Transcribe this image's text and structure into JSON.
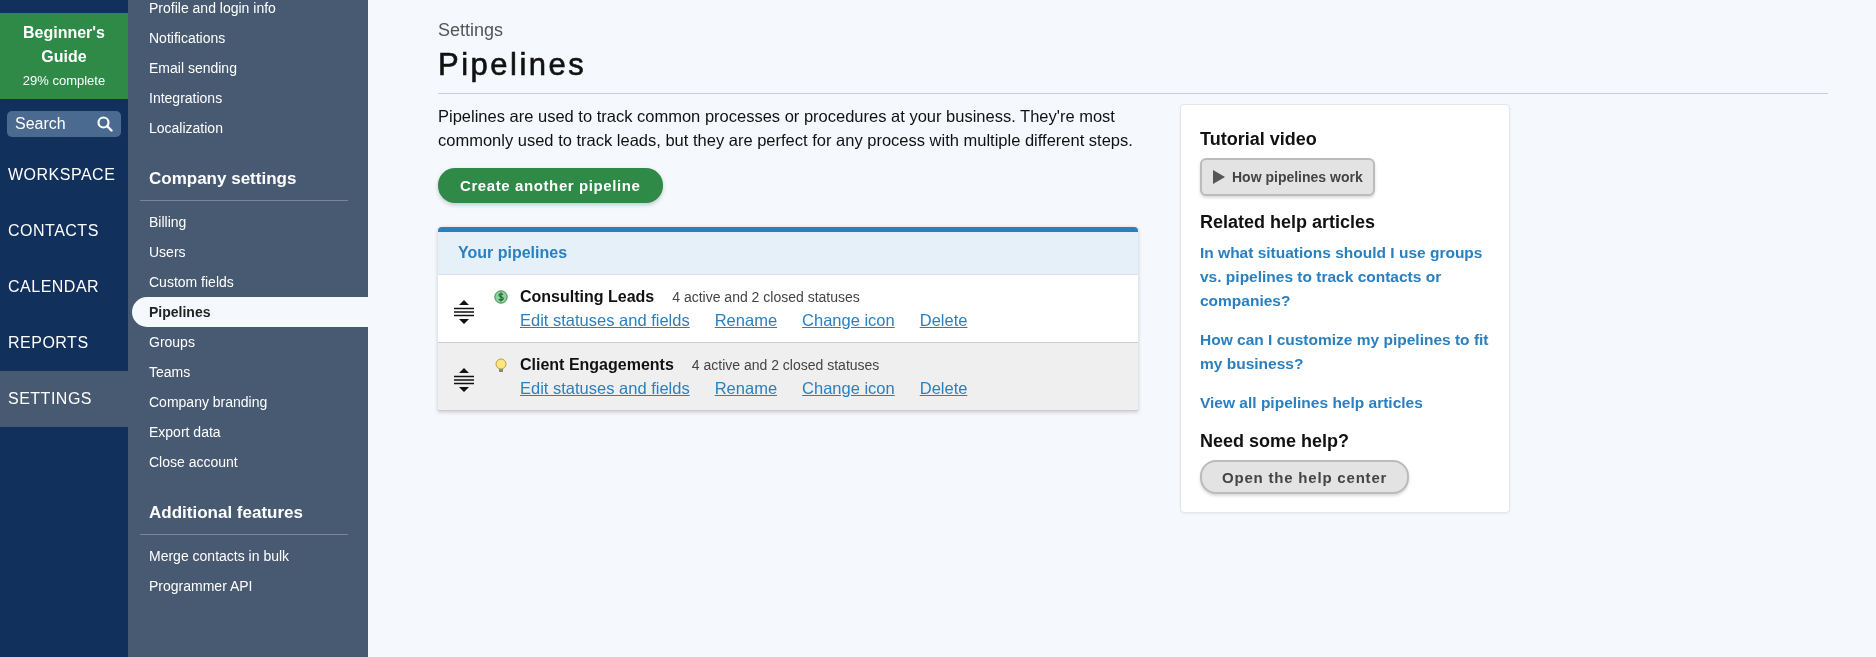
{
  "guide": {
    "title": "Beginner's Guide",
    "progress": "29% complete"
  },
  "search": {
    "placeholder": "Search"
  },
  "main_nav": [
    {
      "label": "WORKSPACE",
      "selected": false
    },
    {
      "label": "CONTACTS",
      "selected": false
    },
    {
      "label": "CALENDAR",
      "selected": false
    },
    {
      "label": "REPORTS",
      "selected": false
    },
    {
      "label": "SETTINGS",
      "selected": true
    }
  ],
  "settings_nav": [
    {
      "items": [
        {
          "label": "Profile and login info",
          "selected": false
        },
        {
          "label": "Notifications",
          "selected": false
        },
        {
          "label": "Email sending",
          "selected": false
        },
        {
          "label": "Integrations",
          "selected": false
        },
        {
          "label": "Localization",
          "selected": false
        }
      ]
    },
    {
      "heading": "Company settings",
      "items": [
        {
          "label": "Billing",
          "selected": false
        },
        {
          "label": "Users",
          "selected": false
        },
        {
          "label": "Custom fields",
          "selected": false
        },
        {
          "label": "Pipelines",
          "selected": true
        },
        {
          "label": "Groups",
          "selected": false
        },
        {
          "label": "Teams",
          "selected": false
        },
        {
          "label": "Company branding",
          "selected": false
        },
        {
          "label": "Export data",
          "selected": false
        },
        {
          "label": "Close account",
          "selected": false
        }
      ]
    },
    {
      "heading": "Additional features",
      "items": [
        {
          "label": "Merge contacts in bulk",
          "selected": false
        },
        {
          "label": "Programmer API",
          "selected": false
        }
      ]
    }
  ],
  "page": {
    "breadcrumb": "Settings",
    "title": "Pipelines",
    "description": "Pipelines are used to track common processes or procedures at your business. They're most commonly used to track leads, but they are perfect for any process with multiple different steps.",
    "create_button": "Create another pipeline"
  },
  "pipelines": {
    "heading": "Your pipelines",
    "rows": [
      {
        "kind": "dollar",
        "name": "Consulting Leads",
        "summary": "4 active and 2 closed statuses",
        "hovered": false,
        "actions": [
          "Edit statuses and fields",
          "Rename",
          "Change icon",
          "Delete"
        ]
      },
      {
        "kind": "bulb",
        "name": "Client Engagements",
        "summary": "4 active and 2 closed statuses",
        "hovered": true,
        "actions": [
          "Edit statuses and fields",
          "Rename",
          "Change icon",
          "Delete"
        ]
      }
    ]
  },
  "help": {
    "video_heading": "Tutorial video",
    "video_button": "How pipelines work",
    "articles_heading": "Related help articles",
    "articles": [
      "In what situations should I use groups vs. pipelines to track contacts or companies?",
      "How can I customize my pipelines to fit my business?",
      "View all pipelines help articles"
    ],
    "support_heading": "Need some help?",
    "support_button": "Open the help center"
  }
}
